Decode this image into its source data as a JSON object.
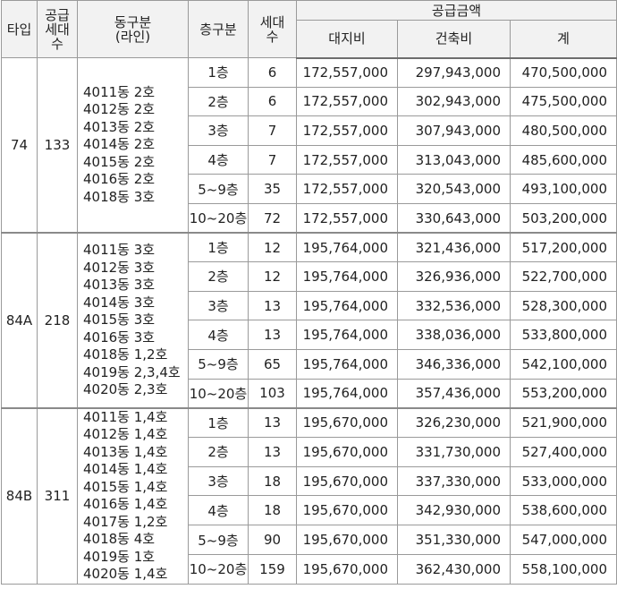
{
  "headers": {
    "type": "타입",
    "supply_units": [
      "공급",
      "세대",
      "수"
    ],
    "dong_line": [
      "동구분",
      "(라인)"
    ],
    "floor": "층구분",
    "units": [
      "세대",
      "수"
    ],
    "supply_price": "공급금액",
    "land": "대지비",
    "building": "건축비",
    "total": "계"
  },
  "groups": [
    {
      "type": "74",
      "supply": "133",
      "dongs": [
        "4011동  2호",
        "4012동  2호",
        "4013동  2호",
        "4014동  2호",
        "4015동  2호",
        "4016동  2호",
        "4018동  3호"
      ],
      "rows": [
        {
          "floor": "1층",
          "units": "6",
          "land": "172,557,000",
          "building": "297,943,000",
          "total": "470,500,000"
        },
        {
          "floor": "2층",
          "units": "6",
          "land": "172,557,000",
          "building": "302,943,000",
          "total": "475,500,000"
        },
        {
          "floor": "3층",
          "units": "7",
          "land": "172,557,000",
          "building": "307,943,000",
          "total": "480,500,000"
        },
        {
          "floor": "4층",
          "units": "7",
          "land": "172,557,000",
          "building": "313,043,000",
          "total": "485,600,000"
        },
        {
          "floor": "5~9층",
          "units": "35",
          "land": "172,557,000",
          "building": "320,543,000",
          "total": "493,100,000"
        },
        {
          "floor": "10~20층",
          "units": "72",
          "land": "172,557,000",
          "building": "330,643,000",
          "total": "503,200,000"
        }
      ]
    },
    {
      "type": "84A",
      "supply": "218",
      "dongs": [
        "4011동  3호",
        "4012동  3호",
        "4013동  3호",
        "4014동  3호",
        "4015동  3호",
        "4016동  3호",
        "4018동  1,2호",
        "4019동  2,3,4호",
        "4020동  2,3호"
      ],
      "rows": [
        {
          "floor": "1층",
          "units": "12",
          "land": "195,764,000",
          "building": "321,436,000",
          "total": "517,200,000"
        },
        {
          "floor": "2층",
          "units": "12",
          "land": "195,764,000",
          "building": "326,936,000",
          "total": "522,700,000"
        },
        {
          "floor": "3층",
          "units": "13",
          "land": "195,764,000",
          "building": "332,536,000",
          "total": "528,300,000"
        },
        {
          "floor": "4층",
          "units": "13",
          "land": "195,764,000",
          "building": "338,036,000",
          "total": "533,800,000"
        },
        {
          "floor": "5~9층",
          "units": "65",
          "land": "195,764,000",
          "building": "346,336,000",
          "total": "542,100,000"
        },
        {
          "floor": "10~20층",
          "units": "103",
          "land": "195,764,000",
          "building": "357,436,000",
          "total": "553,200,000"
        }
      ]
    },
    {
      "type": "84B",
      "supply": "311",
      "dongs": [
        "4011동  1,4호",
        "4012동  1,4호",
        "4013동  1,4호",
        "4014동  1,4호",
        "4015동  1,4호",
        "4016동  1,4호",
        "4017동  1,2호",
        "4018동  4호",
        "4019동  1호",
        "4020동  1,4호"
      ],
      "rows": [
        {
          "floor": "1층",
          "units": "13",
          "land": "195,670,000",
          "building": "326,230,000",
          "total": "521,900,000"
        },
        {
          "floor": "2층",
          "units": "13",
          "land": "195,670,000",
          "building": "331,730,000",
          "total": "527,400,000"
        },
        {
          "floor": "3층",
          "units": "18",
          "land": "195,670,000",
          "building": "337,330,000",
          "total": "533,000,000"
        },
        {
          "floor": "4층",
          "units": "18",
          "land": "195,670,000",
          "building": "342,930,000",
          "total": "538,600,000"
        },
        {
          "floor": "5~9층",
          "units": "90",
          "land": "195,670,000",
          "building": "351,330,000",
          "total": "547,000,000"
        },
        {
          "floor": "10~20층",
          "units": "159",
          "land": "195,670,000",
          "building": "362,430,000",
          "total": "558,100,000"
        }
      ]
    }
  ]
}
